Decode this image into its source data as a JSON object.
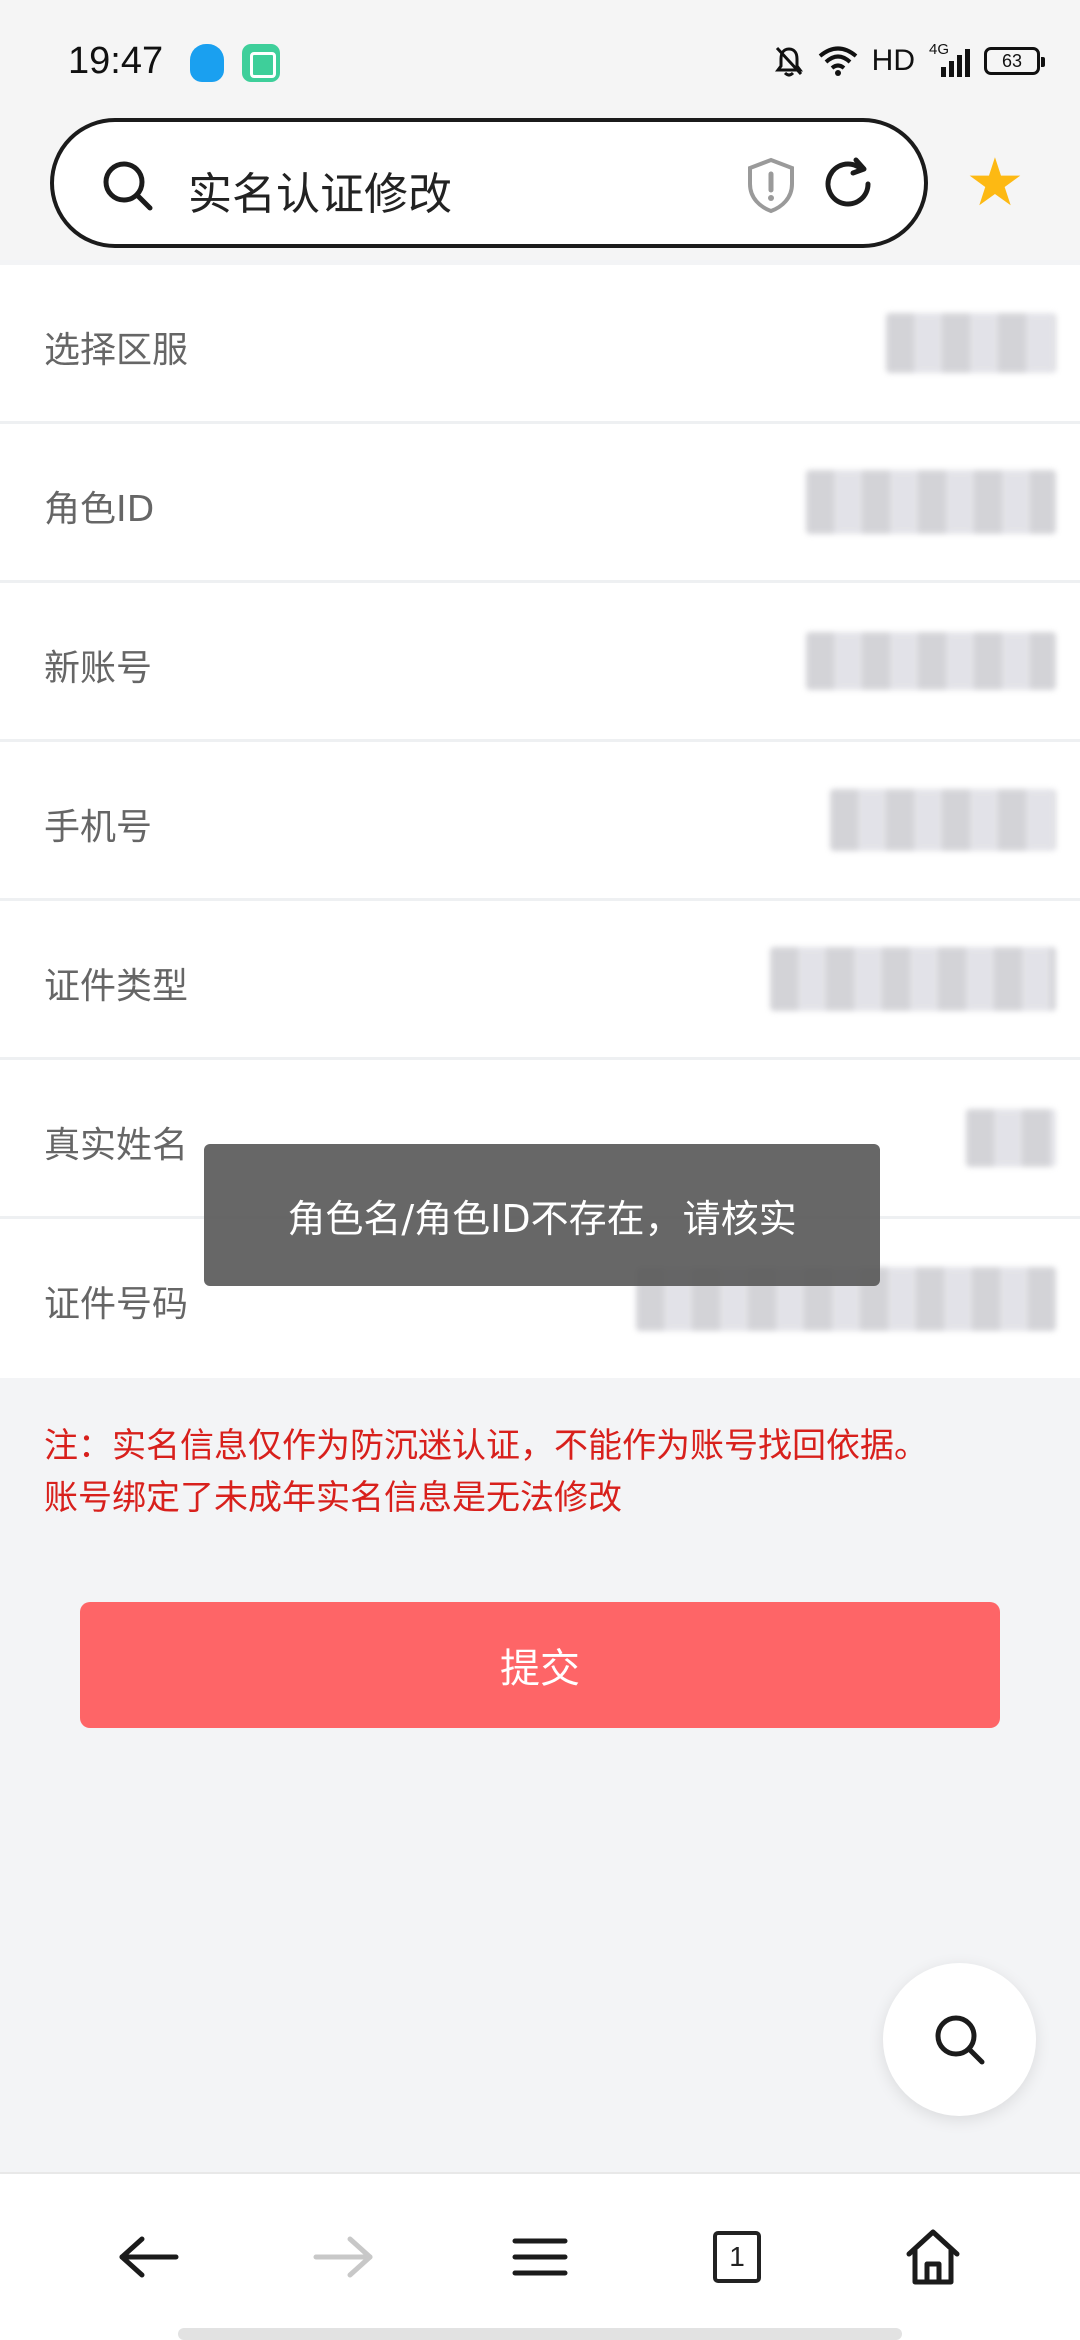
{
  "status_bar": {
    "time": "19:47",
    "network": "HD",
    "signal_label": "4G",
    "battery": "63"
  },
  "search": {
    "query": "实名认证修改"
  },
  "form": {
    "rows": [
      {
        "label": "选择区服"
      },
      {
        "label": "角色ID"
      },
      {
        "label": "新账号"
      },
      {
        "label": "手机号"
      },
      {
        "label": "证件类型"
      },
      {
        "label": "真实姓名"
      },
      {
        "label": "证件号码"
      }
    ]
  },
  "toast": {
    "message": "角色名/角色ID不存在，请核实"
  },
  "notice": {
    "line1": "注：实名信息仅作为防沉迷认证，不能作为账号找回依据。",
    "line2": "账号绑定了未成年实名信息是无法修改"
  },
  "submit": {
    "label": "提交"
  },
  "bottom_nav": {
    "tab_count": "1"
  },
  "colors": {
    "submit_bg": "#fe6567",
    "notice_text": "#d8201c",
    "star": "#fdb913"
  },
  "icons": [
    "qq-icon",
    "app-square-icon",
    "mute-bell-icon",
    "wifi-icon",
    "signal-icon",
    "battery-icon",
    "search-icon",
    "shield-alert-icon",
    "refresh-icon",
    "star-icon",
    "back-arrow-icon",
    "forward-arrow-icon",
    "menu-icon",
    "tabs-icon",
    "home-icon"
  ]
}
